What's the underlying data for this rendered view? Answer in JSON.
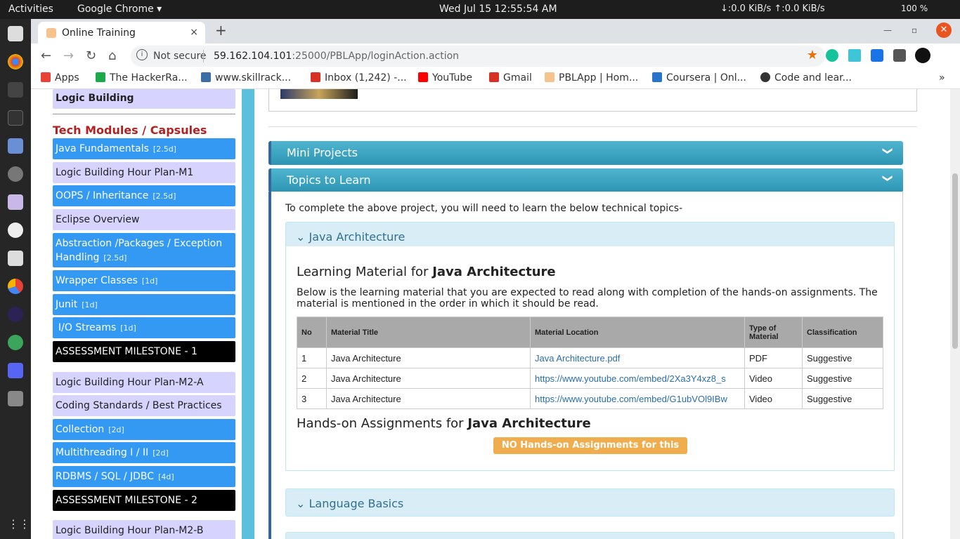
{
  "topbar": {
    "activities": "Activities",
    "app": "Google Chrome ▾",
    "clock": "Wed Jul 15  12:55:54 AM",
    "net": "↓:0.0 KiB/s ↑:0.0 KiB/s",
    "battery": "100 %"
  },
  "tab": {
    "title": "Online Training",
    "close": "×",
    "new": "+"
  },
  "nav": {
    "back": "←",
    "forward": "→",
    "reload": "↻",
    "home": "⌂",
    "info": "i",
    "not_secure": "Not secure",
    "url_host": "59.162.104.101",
    "url_path": ":25000/PBLApp/loginAction.action",
    "star": "★"
  },
  "window": {
    "minimize": "—",
    "maximize": "▫",
    "close": "✕"
  },
  "bookmarks": [
    {
      "label": "Apps",
      "color": "#e94235"
    },
    {
      "label": "The HackerRa...",
      "color": "#1ba94c"
    },
    {
      "label": "www.skillrack...",
      "color": "#3b6ea5"
    },
    {
      "label": "Inbox (1,242) -...",
      "color": "#d93025"
    },
    {
      "label": "YouTube",
      "color": "#ff0000"
    },
    {
      "label": "Gmail",
      "color": "#d93025"
    },
    {
      "label": "PBLApp | Hom...",
      "color": "#f5c38b"
    },
    {
      "label": "Coursera | Onl...",
      "color": "#2a73cc"
    },
    {
      "label": "Code and lear...",
      "color": "#333333"
    }
  ],
  "bookmarks_more": "»",
  "sidebar": {
    "top_item": "Logic Building",
    "heading": "Tech Modules / Capsules",
    "items": [
      {
        "label": "Java Fundamentals",
        "dur": "[2.5d]",
        "style": "blue"
      },
      {
        "label": "Logic Building Hour Plan-M1",
        "dur": "",
        "style": "lav"
      },
      {
        "label": "OOPS / Inheritance",
        "dur": "[2.5d]",
        "style": "blue"
      },
      {
        "label": "Eclipse Overview",
        "dur": "",
        "style": "lav"
      },
      {
        "label": "Abstraction /Packages / Exception Handling",
        "dur": "[2.5d]",
        "style": "blue"
      },
      {
        "label": "Wrapper Classes",
        "dur": "[1d]",
        "style": "blue"
      },
      {
        "label": "Junit",
        "dur": "[1d]",
        "style": "blue"
      },
      {
        "label": "I/O Streams",
        "dur": "[1d]",
        "style": "blue"
      },
      {
        "label": "ASSESSMENT MILESTONE - 1",
        "dur": "",
        "style": "blk"
      },
      {
        "label": "Logic Building Hour Plan-M2-A",
        "dur": "",
        "style": "lav"
      },
      {
        "label": "Coding Standards / Best Practices",
        "dur": "",
        "style": "lav"
      },
      {
        "label": "Collection",
        "dur": "[2d]",
        "style": "blue"
      },
      {
        "label": "Multithreading I / II",
        "dur": "[2d]",
        "style": "blue"
      },
      {
        "label": "RDBMS / SQL / JDBC",
        "dur": "[4d]",
        "style": "blue"
      },
      {
        "label": "ASSESSMENT MILESTONE - 2",
        "dur": "",
        "style": "blk"
      },
      {
        "label": "Logic Building Hour Plan-M2-B",
        "dur": "",
        "style": "lav"
      }
    ]
  },
  "main": {
    "mini_projects": "Mini Projects",
    "topics": "Topics to Learn",
    "intro": "To complete the above project, you will need to learn the below technical topics-",
    "topic1": "Java Architecture",
    "lm_prefix": "Learning Material for ",
    "lm_topic": "Java Architecture",
    "desc": "Below is the learning material that you are expected to read along with completion of the hands-on assignments. The material is mentioned in the order in which it should be read.",
    "table": {
      "headers": [
        "No",
        "Material Title",
        "Material Location",
        "Type of Material",
        "Classification"
      ],
      "rows": [
        [
          "1",
          "Java Architecture",
          "Java Architecture.pdf",
          "PDF",
          "Suggestive"
        ],
        [
          "2",
          "Java Architecture",
          "https://www.youtube.com/embed/2Xa3Y4xz8_s",
          "Video",
          "Suggestive"
        ],
        [
          "3",
          "Java Architecture",
          "https://www.youtube.com/embed/G1ubVOl9IBw",
          "Video",
          "Suggestive"
        ]
      ]
    },
    "ho_prefix": "Hands-on Assignments for ",
    "ho_topic": "Java Architecture",
    "badge": "NO Hands-on Assignments for this topic",
    "topic2": "Language Basics"
  }
}
